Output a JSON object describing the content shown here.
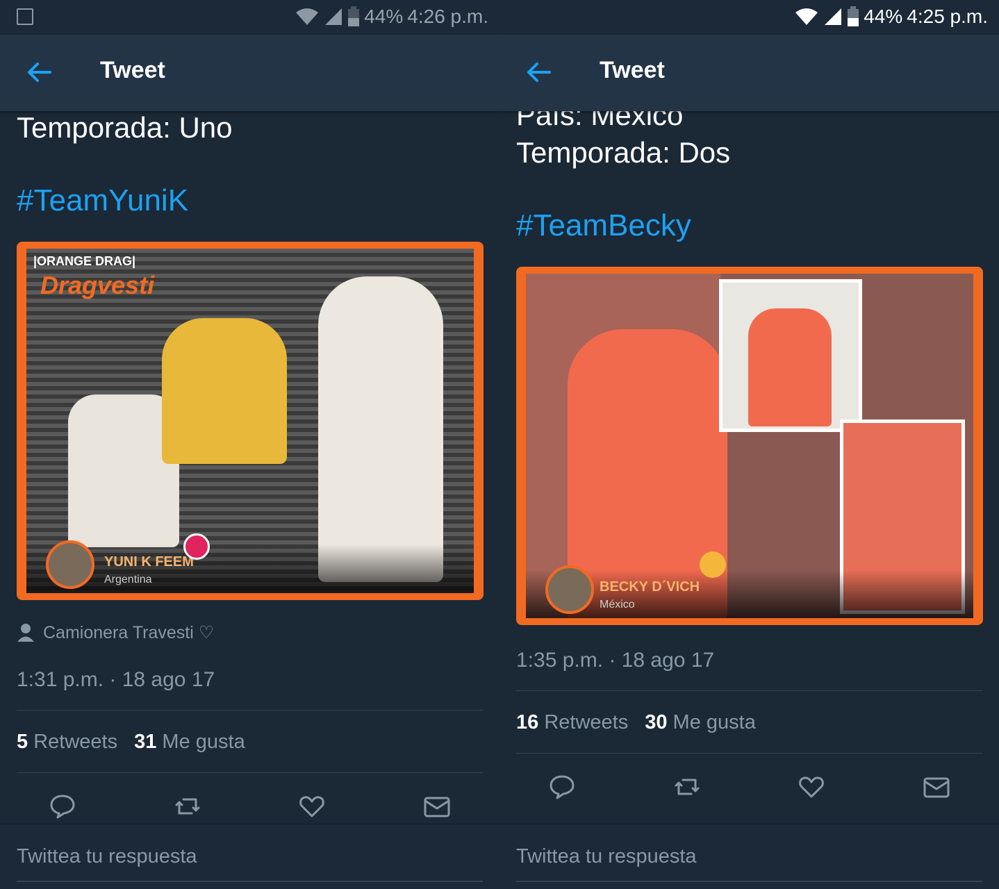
{
  "left": {
    "status": {
      "battery": "44%",
      "time": "4:26 p.m."
    },
    "appbar": {
      "title": "Tweet"
    },
    "tweet": {
      "line1": "Temporada: Uno",
      "hashtag": "#TeamYuniK",
      "media": {
        "name": "YUNI K FEEM",
        "country": "Argentina",
        "brand_top": "|ORANGE DRAG|",
        "brand_logo": "Dragvesti"
      },
      "place": "Camionera Travesti ♡",
      "timestamp": "1:31 p.m. · 18 ago 17",
      "retweets_count": "5",
      "retweets_label": "Retweets",
      "likes_count": "31",
      "likes_label": "Me gusta"
    },
    "reply": {
      "placeholder": "Twittea tu respuesta"
    }
  },
  "right": {
    "status": {
      "battery": "44%",
      "time": "4:25 p.m."
    },
    "appbar": {
      "title": "Tweet"
    },
    "tweet": {
      "line0": "País: México",
      "line1": "Temporada: Dos",
      "hashtag": "#TeamBecky",
      "media": {
        "name": "BECKY D´VICH",
        "country": "México"
      },
      "timestamp": "1:35 p.m. · 18 ago 17",
      "retweets_count": "16",
      "retweets_label": "Retweets",
      "likes_count": "30",
      "likes_label": "Me gusta"
    },
    "reply": {
      "placeholder": "Twittea tu respuesta"
    }
  },
  "icons": [
    "back-arrow-icon",
    "reply-icon",
    "retweet-icon",
    "like-icon",
    "dm-icon",
    "wifi-icon",
    "signal-icon",
    "battery-icon",
    "person-icon",
    "image-icon"
  ],
  "colors": {
    "background": "#1b2836",
    "appbar": "#243447",
    "accent": "#1da1f2",
    "muted": "#8899a6",
    "media_frame": "#f26a21"
  }
}
